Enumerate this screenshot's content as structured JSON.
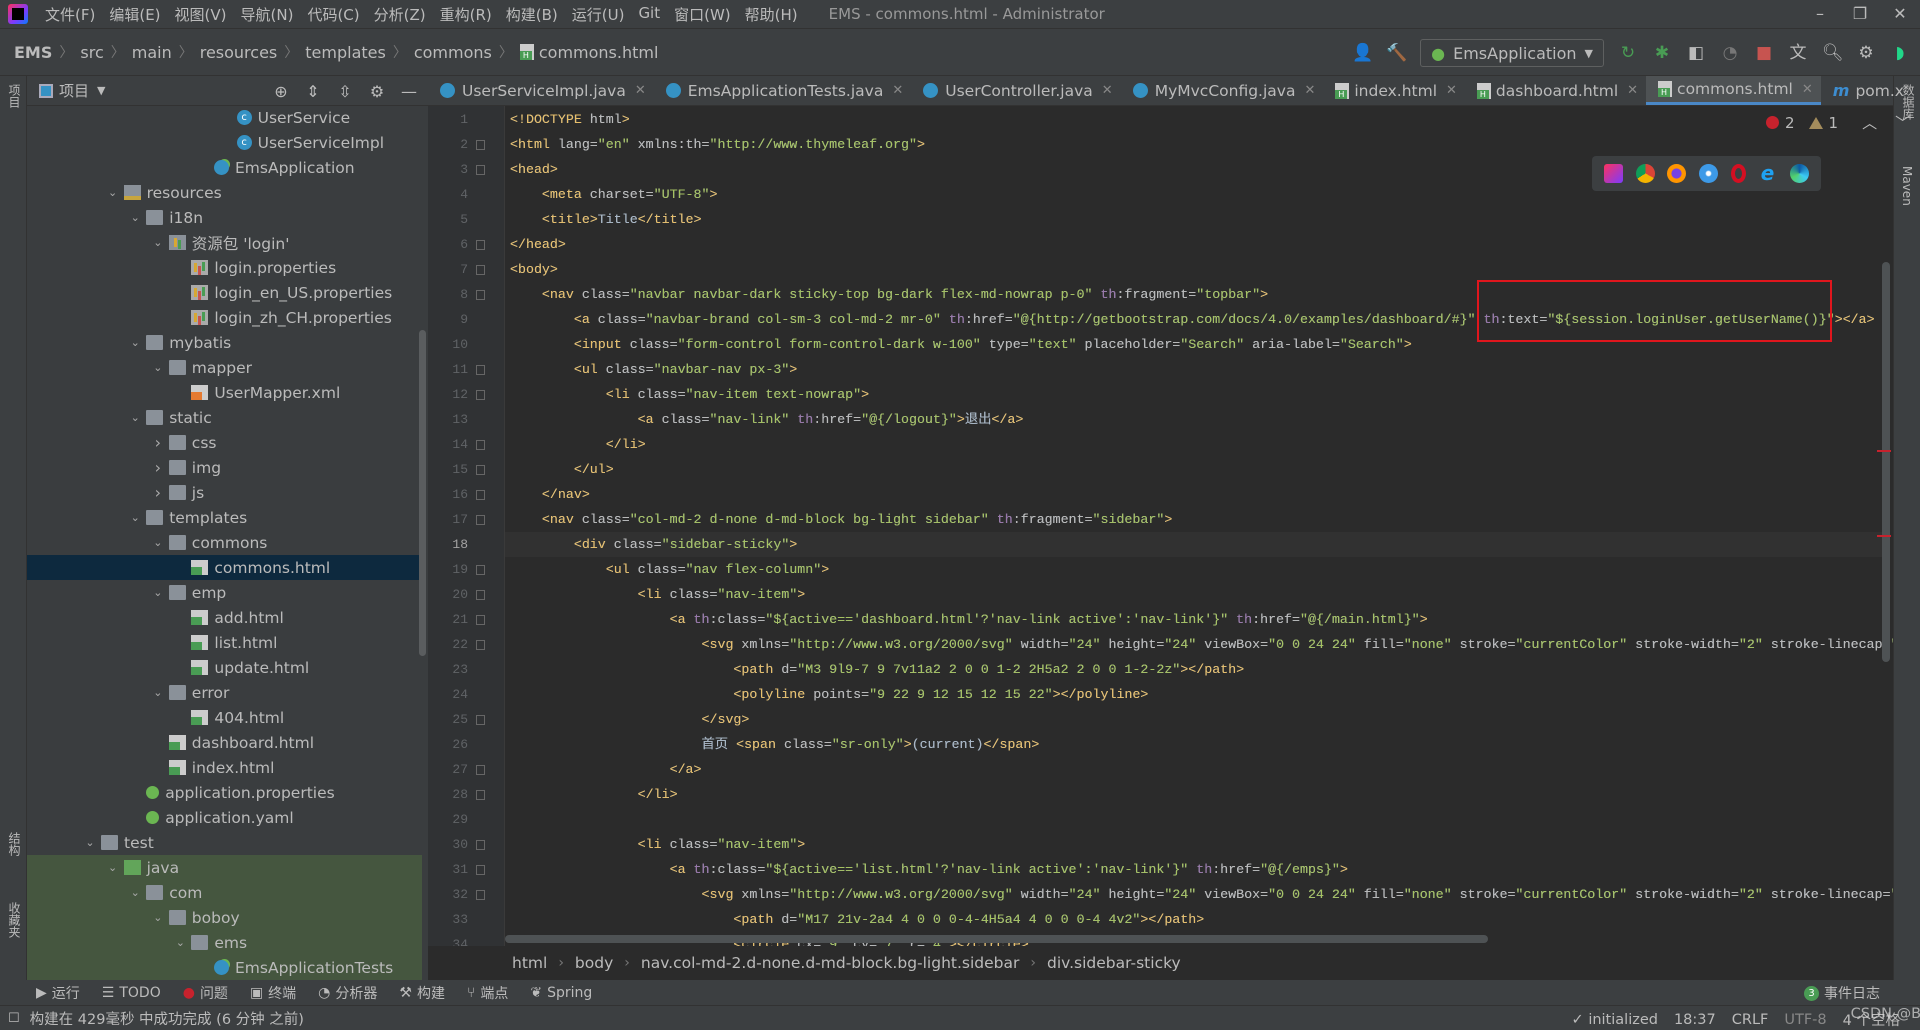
{
  "titlebar": {
    "menu": [
      "文件(F)",
      "编辑(E)",
      "视图(V)",
      "导航(N)",
      "代码(C)",
      "分析(Z)",
      "重构(R)",
      "构建(B)",
      "运行(U)",
      "Git",
      "窗口(W)",
      "帮助(H)"
    ],
    "title": "EMS - commons.html - Administrator"
  },
  "navbar": {
    "breadcrumb": [
      "EMS",
      "src",
      "main",
      "resources",
      "templates",
      "commons",
      "commons.html"
    ],
    "run_config": "EmsApplication"
  },
  "left_strip": {
    "project": "项目",
    "structure": "结构",
    "favorites": "收藏夹"
  },
  "right_strip": {
    "database": "数据库",
    "maven": "Maven"
  },
  "project": {
    "title": "项目",
    "tree": [
      {
        "name": "UserService",
        "depth": 6,
        "icon": "class",
        "arrow": ""
      },
      {
        "name": "UserServiceImpl",
        "depth": 6,
        "icon": "class",
        "arrow": ""
      },
      {
        "name": "EmsApplication",
        "depth": 5,
        "icon": "spring",
        "arrow": ""
      },
      {
        "name": "resources",
        "depth": 1,
        "icon": "folder-res",
        "arrow": "open"
      },
      {
        "name": "i18n",
        "depth": 2,
        "icon": "folder",
        "arrow": "open"
      },
      {
        "name": "资源包 'login'",
        "depth": 3,
        "icon": "bundle",
        "arrow": "open"
      },
      {
        "name": "login.properties",
        "depth": 4,
        "icon": "props",
        "arrow": ""
      },
      {
        "name": "login_en_US.properties",
        "depth": 4,
        "icon": "props",
        "arrow": ""
      },
      {
        "name": "login_zh_CH.properties",
        "depth": 4,
        "icon": "props",
        "arrow": ""
      },
      {
        "name": "mybatis",
        "depth": 2,
        "icon": "folder",
        "arrow": "open"
      },
      {
        "name": "mapper",
        "depth": 3,
        "icon": "folder",
        "arrow": "open"
      },
      {
        "name": "UserMapper.xml",
        "depth": 4,
        "icon": "xml",
        "arrow": ""
      },
      {
        "name": "static",
        "depth": 2,
        "icon": "folder",
        "arrow": "open"
      },
      {
        "name": "css",
        "depth": 3,
        "icon": "folder",
        "arrow": "closed"
      },
      {
        "name": "img",
        "depth": 3,
        "icon": "folder",
        "arrow": "closed"
      },
      {
        "name": "js",
        "depth": 3,
        "icon": "folder",
        "arrow": "closed"
      },
      {
        "name": "templates",
        "depth": 2,
        "icon": "folder",
        "arrow": "open"
      },
      {
        "name": "commons",
        "depth": 3,
        "icon": "folder",
        "arrow": "open"
      },
      {
        "name": "commons.html",
        "depth": 4,
        "icon": "html",
        "arrow": "",
        "selected": true
      },
      {
        "name": "emp",
        "depth": 3,
        "icon": "folder",
        "arrow": "open"
      },
      {
        "name": "add.html",
        "depth": 4,
        "icon": "html",
        "arrow": ""
      },
      {
        "name": "list.html",
        "depth": 4,
        "icon": "html",
        "arrow": ""
      },
      {
        "name": "update.html",
        "depth": 4,
        "icon": "html",
        "arrow": ""
      },
      {
        "name": "error",
        "depth": 3,
        "icon": "folder",
        "arrow": "open"
      },
      {
        "name": "404.html",
        "depth": 4,
        "icon": "html",
        "arrow": ""
      },
      {
        "name": "dashboard.html",
        "depth": 3,
        "icon": "html",
        "arrow": ""
      },
      {
        "name": "index.html",
        "depth": 3,
        "icon": "html",
        "arrow": ""
      },
      {
        "name": "application.properties",
        "depth": 2,
        "icon": "yaml",
        "arrow": ""
      },
      {
        "name": "application.yaml",
        "depth": 2,
        "icon": "yaml",
        "arrow": ""
      },
      {
        "name": "test",
        "depth": 0,
        "icon": "folder",
        "arrow": "open"
      },
      {
        "name": "java",
        "depth": 1,
        "icon": "folder-test",
        "arrow": "open",
        "test": true
      },
      {
        "name": "com",
        "depth": 2,
        "icon": "folder",
        "arrow": "open",
        "test": true
      },
      {
        "name": "boboy",
        "depth": 3,
        "icon": "folder",
        "arrow": "open",
        "test": true
      },
      {
        "name": "ems",
        "depth": 4,
        "icon": "folder",
        "arrow": "open",
        "test": true
      },
      {
        "name": "EmsApplicationTests",
        "depth": 5,
        "icon": "spring",
        "arrow": "",
        "test": true
      }
    ]
  },
  "tabs": [
    {
      "label": "UserServiceImpl.java",
      "icon": "class"
    },
    {
      "label": "EmsApplicationTests.java",
      "icon": "class"
    },
    {
      "label": "UserController.java",
      "icon": "class"
    },
    {
      "label": "MyMvcConfig.java",
      "icon": "class"
    },
    {
      "label": "index.html",
      "icon": "html"
    },
    {
      "label": "dashboard.html",
      "icon": "html"
    },
    {
      "label": "commons.html",
      "icon": "html",
      "active": true
    },
    {
      "label": "pom.x",
      "icon": "maven"
    }
  ],
  "editor": {
    "current_line": 18,
    "errors": "2",
    "warnings": "1",
    "lines": [
      "<!DOCTYPE html>",
      "<html lang=\"en\" xmlns:th=\"http://www.thymeleaf.org\">",
      "<head>",
      "    <meta charset=\"UTF-8\">",
      "    <title>Title</title>",
      "</head>",
      "<body>",
      "    <nav class=\"navbar navbar-dark sticky-top bg-dark flex-md-nowrap p-0\" th:fragment=\"topbar\">",
      "        <a class=\"navbar-brand col-sm-3 col-md-2 mr-0\" th:href=\"@{http://getbootstrap.com/docs/4.0/examples/dashboard/#}\" th:text=\"${session.loginUser.getUserName()}\"></a>",
      "        <input class=\"form-control form-control-dark w-100\" type=\"text\" placeholder=\"Search\" aria-label=\"Search\">",
      "        <ul class=\"navbar-nav px-3\">",
      "            <li class=\"nav-item text-nowrap\">",
      "                <a class=\"nav-link\" th:href=\"@{/logout}\">退出</a>",
      "            </li>",
      "        </ul>",
      "    </nav>",
      "    <nav class=\"col-md-2 d-none d-md-block bg-light sidebar\" th:fragment=\"sidebar\">",
      "        <div class=\"sidebar-sticky\">",
      "            <ul class=\"nav flex-column\">",
      "                <li class=\"nav-item\">",
      "                    <a th:class=\"${active=='dashboard.html'?'nav-link active':'nav-link'}\" th:href=\"@{/main.html}\">",
      "                        <svg xmlns=\"http://www.w3.org/2000/svg\" width=\"24\" height=\"24\" viewBox=\"0 0 24 24\" fill=\"none\" stroke=\"currentColor\" stroke-width=\"2\" stroke-linecap=\"",
      "                            <path d=\"M3 9l9-7 9 7v11a2 2 0 0 1-2 2H5a2 2 0 0 1-2-2z\"></path>",
      "                            <polyline points=\"9 22 9 12 15 12 15 22\"></polyline>",
      "                        </svg>",
      "                        首页 <span class=\"sr-only\">(current)</span>",
      "                    </a>",
      "                </li>",
      "",
      "                <li class=\"nav-item\">",
      "                    <a th:class=\"${active=='list.html'?'nav-link active':'nav-link'}\" th:href=\"@{/emps}\">",
      "                        <svg xmlns=\"http://www.w3.org/2000/svg\" width=\"24\" height=\"24\" viewBox=\"0 0 24 24\" fill=\"none\" stroke=\"currentColor\" stroke-width=\"2\" stroke-linecap=\"",
      "                            <path d=\"M17 21v-2a4 4 0 0 0-4-4H5a4 4 0 0 0-4 4v2\"></path>",
      "                            <circle cx=\"9\" cy=\"7\" r=\"4\"></circle>"
    ],
    "breadcrumb": [
      "html",
      "body",
      "nav.col-md-2.d-none.d-md-block.bg-light.sidebar",
      "div.sidebar-sticky"
    ]
  },
  "toolwindows": [
    {
      "label": "运行",
      "icon": "run-icon"
    },
    {
      "label": "TODO",
      "icon": "todo-icon"
    },
    {
      "label": "问题",
      "icon": "problems-icon"
    },
    {
      "label": "终端",
      "icon": "terminal-icon"
    },
    {
      "label": "分析器",
      "icon": "profiler-icon"
    },
    {
      "label": "构建",
      "icon": "build-icon"
    },
    {
      "label": "端点",
      "icon": "endpoints-icon"
    },
    {
      "label": "Spring",
      "icon": "spring-icon"
    }
  ],
  "event_log": {
    "count": "3",
    "label": "事件日志"
  },
  "status": {
    "message": "构建在 429毫秒 中成功完成 (6 分钟 之前)",
    "initialized": "initialized",
    "position": "18:37",
    "line_sep": "CRLF",
    "encoding": "UTF-8",
    "indent": "4 个空格",
    "watermark": "CSDN @BoBooY"
  },
  "colors": {
    "accent": "#4a88c7",
    "selection": "#0d293e",
    "error": "#c7222d",
    "highlight_box": "#e0161d"
  }
}
